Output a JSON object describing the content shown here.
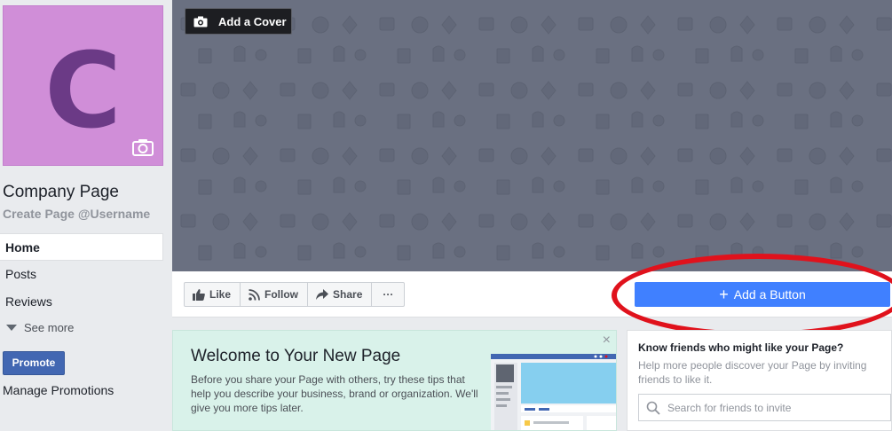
{
  "profile": {
    "letter": "C",
    "name": "Company Page",
    "username": "Create Page @Username",
    "camera_icon": "camera-icon"
  },
  "nav": {
    "items": [
      {
        "label": "Home",
        "active": true
      },
      {
        "label": "Posts",
        "active": false
      },
      {
        "label": "Reviews",
        "active": false
      }
    ],
    "see_more": "See more"
  },
  "sidebar": {
    "promote_label": "Promote",
    "manage_promotions": "Manage Promotions"
  },
  "cover": {
    "add_cover_label": "Add a Cover",
    "bg_color": "#6a7081"
  },
  "actions": {
    "like": "Like",
    "follow": "Follow",
    "share": "Share",
    "more": "···",
    "add_button": "Add a Button",
    "cta_color": "#4080ff"
  },
  "welcome": {
    "title": "Welcome to Your New Page",
    "text": "Before you share your Page with others, try these tips that help you describe your business, brand or organization. We'll give you more tips later.",
    "close": "×"
  },
  "invite": {
    "title": "Know friends who might like your Page?",
    "description": "Help more people discover your Page by inviting friends to like it.",
    "search_placeholder": "Search for friends to invite"
  },
  "colors": {
    "brand_blue": "#4267b2",
    "highlight_red": "#e0121c",
    "profile_bg": "#d08ed8",
    "profile_letter": "#6b3a86"
  }
}
